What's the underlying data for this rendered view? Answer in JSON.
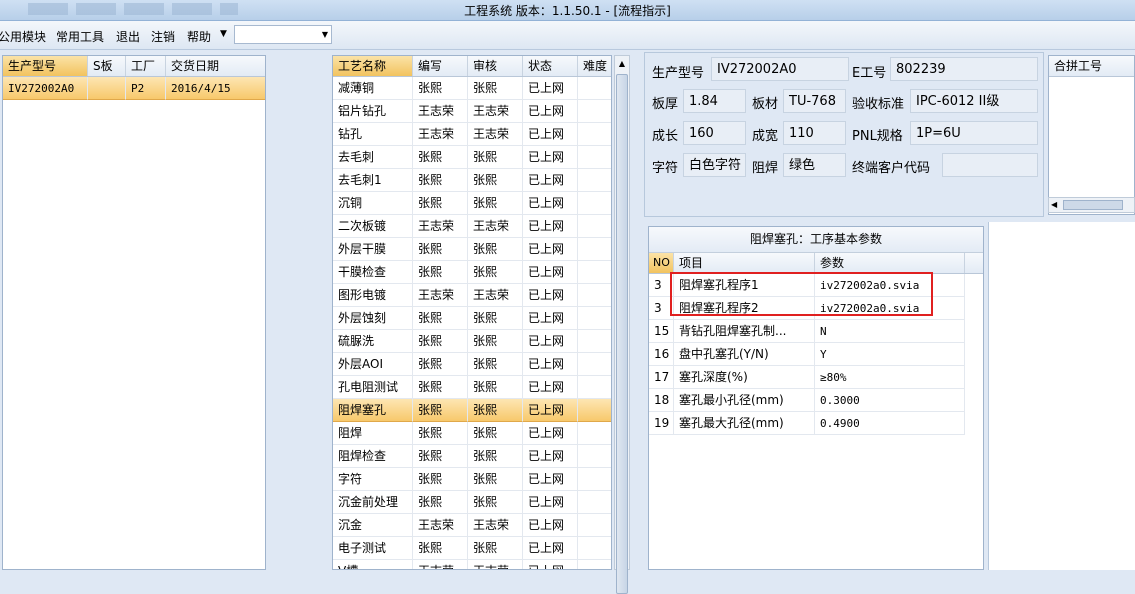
{
  "window": {
    "title": "工程系统   版本：1.1.50.1 - [流程指示]"
  },
  "menu": {
    "items": [
      "公用模块",
      "常用工具",
      "退出",
      "注销",
      "帮助"
    ],
    "combo_value": ""
  },
  "orders": {
    "columns": [
      "生产型号",
      "S板",
      "工厂",
      "交货日期"
    ],
    "rows": [
      [
        "IV272002A0",
        "",
        "P2",
        "2016/4/15"
      ]
    ]
  },
  "process": {
    "columns": [
      "工艺名称",
      "编写",
      "审核",
      "状态",
      "难度"
    ],
    "rows": [
      [
        "减薄铜",
        "张熙",
        "张熙",
        "已上网",
        ""
      ],
      [
        "铝片钻孔",
        "王志荣",
        "王志荣",
        "已上网",
        ""
      ],
      [
        "钻孔",
        "王志荣",
        "王志荣",
        "已上网",
        ""
      ],
      [
        "去毛刺",
        "张熙",
        "张熙",
        "已上网",
        ""
      ],
      [
        "去毛刺1",
        "张熙",
        "张熙",
        "已上网",
        ""
      ],
      [
        "沉铜",
        "张熙",
        "张熙",
        "已上网",
        ""
      ],
      [
        "二次板镀",
        "王志荣",
        "王志荣",
        "已上网",
        ""
      ],
      [
        "外层干膜",
        "张熙",
        "张熙",
        "已上网",
        ""
      ],
      [
        "干膜检查",
        "张熙",
        "张熙",
        "已上网",
        ""
      ],
      [
        "图形电镀",
        "王志荣",
        "王志荣",
        "已上网",
        ""
      ],
      [
        "外层蚀刻",
        "张熙",
        "张熙",
        "已上网",
        ""
      ],
      [
        "硫脲洗",
        "张熙",
        "张熙",
        "已上网",
        ""
      ],
      [
        "外层AOI",
        "张熙",
        "张熙",
        "已上网",
        ""
      ],
      [
        "孔电阻测试",
        "张熙",
        "张熙",
        "已上网",
        ""
      ],
      [
        "阻焊塞孔",
        "张熙",
        "张熙",
        "已上网",
        ""
      ],
      [
        "阻焊",
        "张熙",
        "张熙",
        "已上网",
        ""
      ],
      [
        "阻焊检查",
        "张熙",
        "张熙",
        "已上网",
        ""
      ],
      [
        "字符",
        "张熙",
        "张熙",
        "已上网",
        ""
      ],
      [
        "沉金前处理",
        "张熙",
        "张熙",
        "已上网",
        ""
      ],
      [
        "沉金",
        "王志荣",
        "王志荣",
        "已上网",
        ""
      ],
      [
        "电子测试",
        "张熙",
        "张熙",
        "已上网",
        ""
      ],
      [
        "V槽",
        "王志荣",
        "王志荣",
        "已上网",
        ""
      ]
    ],
    "selected_index": 14
  },
  "info": {
    "model_label": "生产型号",
    "model_value": "IV272002A0",
    "eno_label": "E工号",
    "eno_value": "802239",
    "thick_label": "板厚",
    "thick_value": "1.84",
    "material_label": "板材",
    "material_value": "TU-768",
    "standard_label": "验收标准",
    "standard_value": "IPC-6012 II级",
    "length_label": "成长",
    "length_value": "160",
    "width_label": "成宽",
    "width_value": "110",
    "pnl_label": "PNL规格",
    "pnl_value": "1P=6U",
    "char_label": "字符",
    "char_value": "白色字符",
    "mask_label": "阻焊",
    "mask_value": "绿色",
    "customer_label": "终端客户代码",
    "customer_value": ""
  },
  "merge": {
    "header": "合拼工号"
  },
  "params": {
    "title": "阻焊塞孔：工序基本参数",
    "columns": [
      "NO",
      "项目",
      "参数"
    ],
    "rows": [
      [
        "3",
        "阻焊塞孔程序1",
        "iv272002a0.svia"
      ],
      [
        "3",
        "阻焊塞孔程序2",
        "iv272002a0.svia"
      ],
      [
        "15",
        "背钻孔阻焊塞孔制...",
        "N"
      ],
      [
        "16",
        "盘中孔塞孔(Y/N)",
        "Y"
      ],
      [
        "17",
        "塞孔深度(%)",
        "≥80%"
      ],
      [
        "18",
        "塞孔最小孔径(mm)",
        "0.3000"
      ],
      [
        "19",
        "塞孔最大孔径(mm)",
        "0.4900"
      ]
    ]
  }
}
